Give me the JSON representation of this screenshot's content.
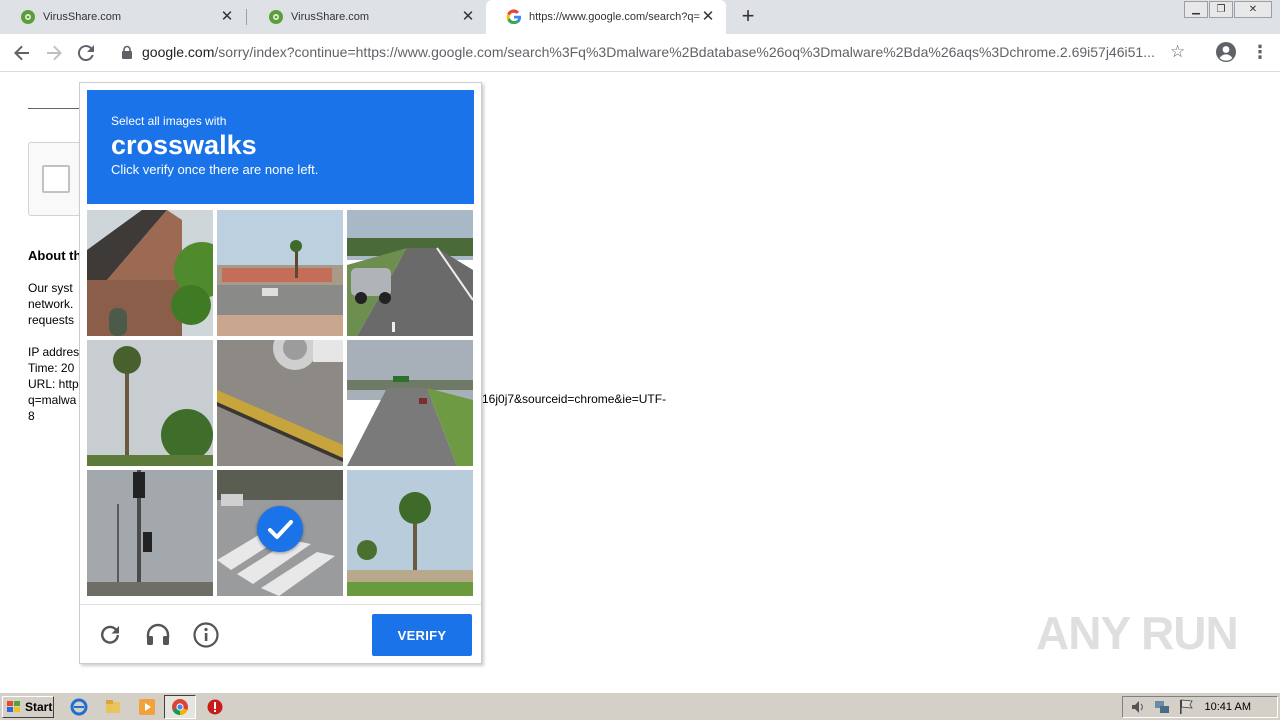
{
  "browser": {
    "tabs": [
      {
        "title": "VirusShare.com",
        "active": false
      },
      {
        "title": "VirusShare.com",
        "active": false
      },
      {
        "title": "https://www.google.com/search?q=",
        "active": true
      }
    ],
    "new_tab": "+",
    "address_host": "google.com",
    "address_rest": "/sorry/index?continue=https://www.google.com/search%3Fq%3Dmalware%2Bdatabase%26oq%3Dmalware%2Bda%26aqs%3Dchrome.2.69i57j46i51..."
  },
  "page": {
    "about_heading": "About th",
    "system_lines": [
      "Our syst",
      "network.",
      "requests"
    ],
    "info_lines": [
      "IP addres",
      "Time: 20",
      "URL: http",
      "q=malwa",
      "8"
    ],
    "url_tail": "16j0j7&sourceid=chrome&ie=UTF-"
  },
  "captcha": {
    "subtitle": "Select all images with",
    "keyword": "crosswalks",
    "instruction": "Click verify once there are none left.",
    "verify_label": "VERIFY",
    "tiles": [
      {
        "name": "tile-house-roof",
        "selected": false
      },
      {
        "name": "tile-storefront",
        "selected": false
      },
      {
        "name": "tile-highway-car",
        "selected": false
      },
      {
        "name": "tile-palm-tree",
        "selected": false
      },
      {
        "name": "tile-road-closeup",
        "selected": false
      },
      {
        "name": "tile-highway-sign",
        "selected": false
      },
      {
        "name": "tile-traffic-light",
        "selected": false
      },
      {
        "name": "tile-crosswalk",
        "selected": true
      },
      {
        "name": "tile-palm-beach",
        "selected": false
      }
    ]
  },
  "watermark": "ANY RUN",
  "taskbar": {
    "start_label": "Start",
    "clock": "10:41 AM"
  }
}
